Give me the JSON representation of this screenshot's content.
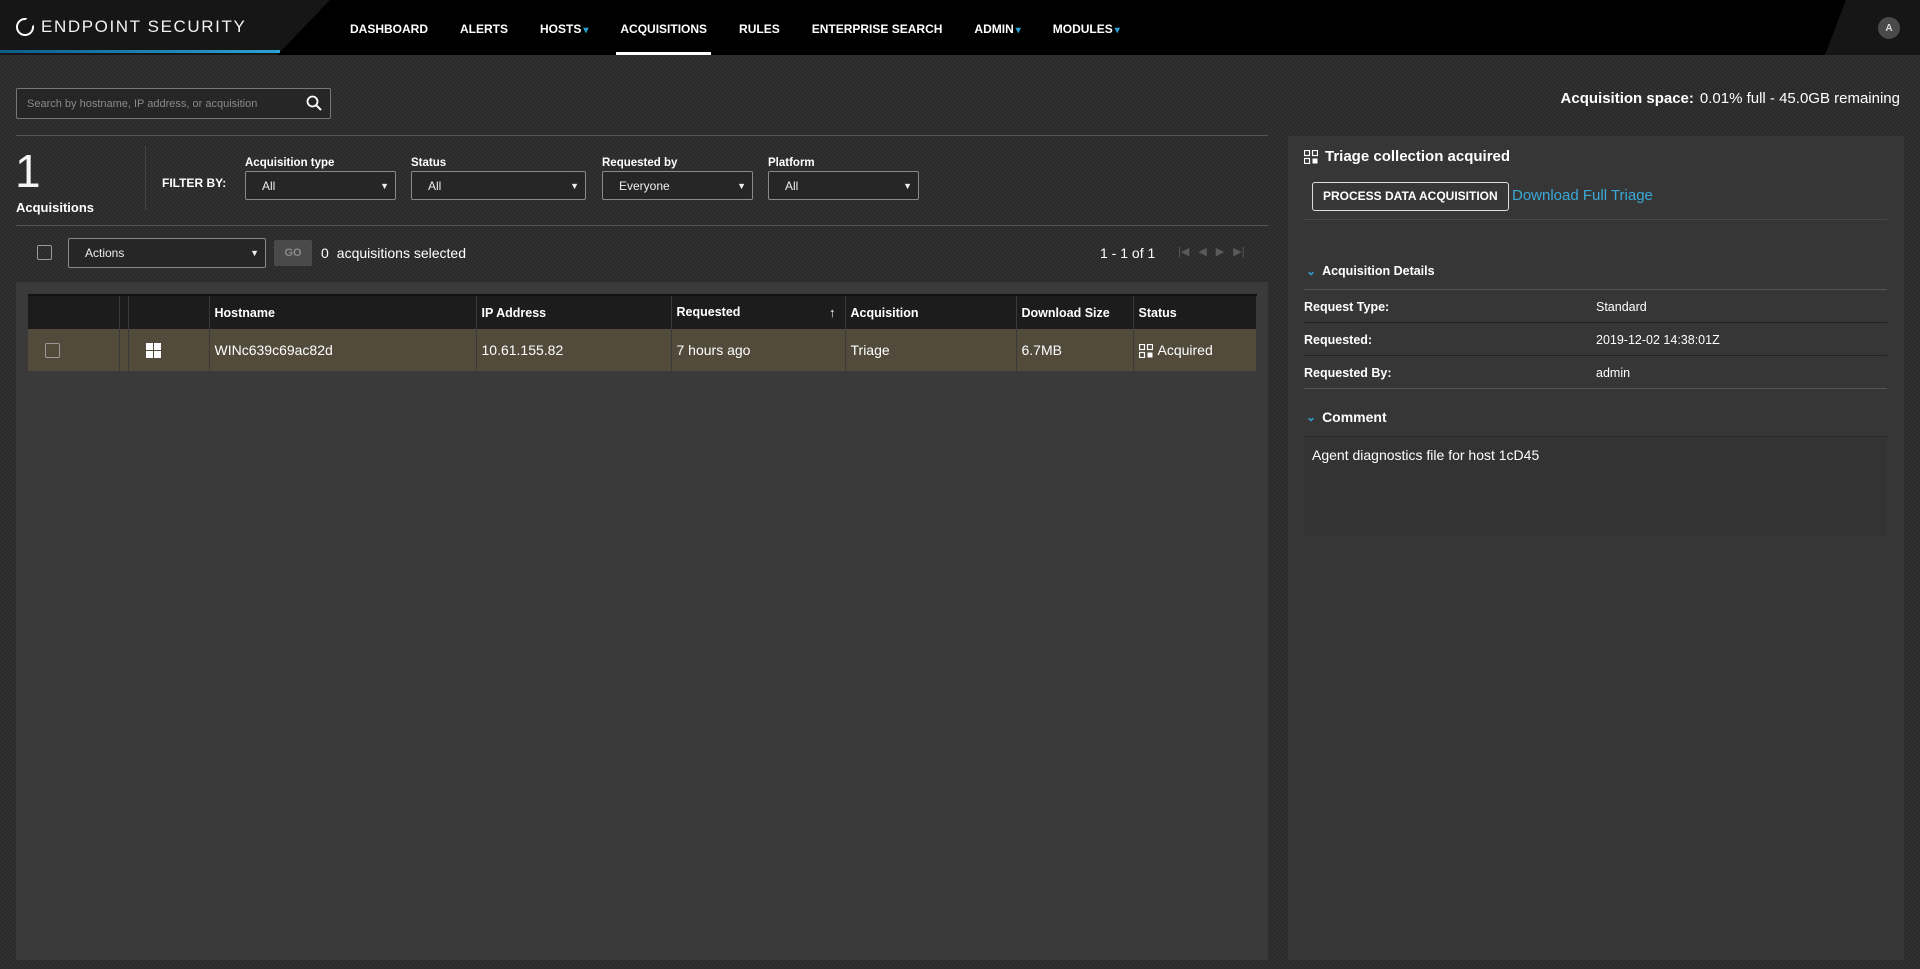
{
  "app": {
    "brand": "ENDPOINT SECURITY",
    "user_initial": "A"
  },
  "nav": [
    {
      "label": "DASHBOARD",
      "dropdown": false
    },
    {
      "label": "ALERTS",
      "dropdown": false
    },
    {
      "label": "HOSTS",
      "dropdown": true
    },
    {
      "label": "ACQUISITIONS",
      "dropdown": false,
      "active": true
    },
    {
      "label": "RULES",
      "dropdown": false
    },
    {
      "label": "ENTERPRISE SEARCH",
      "dropdown": false
    },
    {
      "label": "ADMIN",
      "dropdown": true
    },
    {
      "label": "MODULES",
      "dropdown": true
    }
  ],
  "search": {
    "placeholder": "Search by hostname, IP address, or acquisition"
  },
  "acquisition_space": {
    "label": "Acquisition space:",
    "value": "0.01% full - 45.0GB remaining"
  },
  "summary": {
    "count": "1",
    "label": "Acquisitions"
  },
  "filters": {
    "label": "FILTER BY:",
    "items": [
      {
        "label": "Acquisition type",
        "value": "All"
      },
      {
        "label": "Status",
        "value": "All"
      },
      {
        "label": "Requested by",
        "value": "Everyone"
      },
      {
        "label": "Platform",
        "value": "All"
      }
    ]
  },
  "actions": {
    "select_value": "Actions",
    "go_label": "GO",
    "selected_count": "0",
    "selected_label": "acquisitions selected"
  },
  "pagination": {
    "text": "1 - 1 of 1"
  },
  "table": {
    "columns": [
      "Hostname",
      "IP Address",
      "Requested",
      "Acquisition",
      "Download Size",
      "Status"
    ],
    "rows": [
      {
        "platform": "windows-icon",
        "hostname": "WINc639c69ac82d",
        "ip": "10.61.155.82",
        "requested": "7 hours ago",
        "acquisition": "Triage",
        "size": "6.7MB",
        "status": "Acquired"
      }
    ]
  },
  "details": {
    "title": "Triage collection acquired",
    "process_button": "PROCESS DATA ACQUISITION",
    "download_link": "Download Full Triage",
    "section_details": "Acquisition Details",
    "fields": [
      {
        "key": "Request Type:",
        "value": "Standard"
      },
      {
        "key": "Requested:",
        "value": "2019-12-02 14:38:01Z"
      },
      {
        "key": "Requested By:",
        "value": "admin"
      }
    ],
    "section_comment": "Comment",
    "comment": "Agent diagnostics file for host 1cD45"
  },
  "colors": {
    "accent": "#2ba2d4",
    "link": "#3aa9d8",
    "row_highlight": "#524b3c",
    "topbar": "#000000"
  }
}
